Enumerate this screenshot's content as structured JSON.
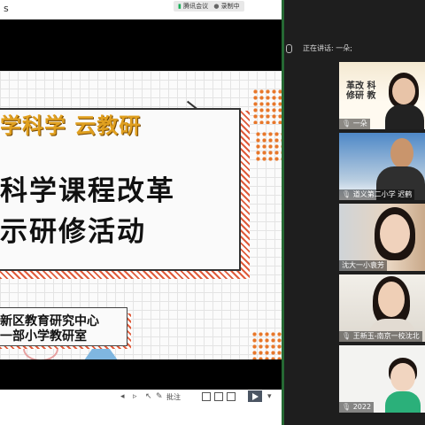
{
  "topbar": {
    "app_label": "腾讯会议",
    "recording_label": "录制中",
    "share_caption": "s"
  },
  "slide": {
    "subtitle": "学科学 云教研",
    "title_line1": "科学课程改革",
    "title_line2": "示研修活动",
    "org_line1": "新区教育研究中心",
    "org_line2": "一部小学教研室"
  },
  "toolbar": {
    "annotate_label": "批注"
  },
  "side_panel": {
    "speaking_label": "正在讲话: 一朵;",
    "participants": [
      {
        "name": "一朵",
        "poster_text": "革改 科 修研 教"
      },
      {
        "name": "道义第二小学 迟鹤"
      },
      {
        "name": "沈大一小袁芳"
      },
      {
        "name": "王新玉-南京一校沈北"
      },
      {
        "name": "2022"
      }
    ]
  },
  "colors": {
    "accent_green": "#2db34a",
    "slide_orange": "#e8772a",
    "slide_gold": "#e0a020"
  }
}
